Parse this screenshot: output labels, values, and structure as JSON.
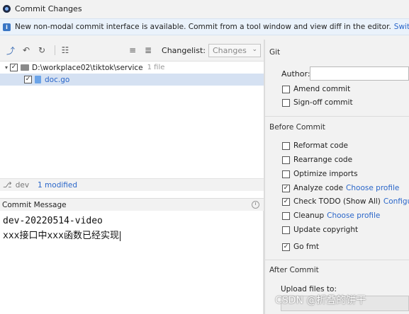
{
  "window": {
    "title": "Commit Changes"
  },
  "banner": {
    "text": "New non-modal commit interface is available. Commit from a tool window and view diff in the editor.",
    "link": "Switch to tool wi"
  },
  "toolbar": {
    "changelist_label": "Changelist:",
    "changelist_value": "Changes"
  },
  "tree": {
    "root_path": "D:\\workplace02\\tiktok\\service",
    "root_meta": "1 file",
    "file": "doc.go"
  },
  "status": {
    "branch": "dev",
    "modified": "1 modified"
  },
  "commit_message": {
    "label": "Commit Message",
    "lines": [
      "dev-20220514-video",
      "xxx接口中xxx函数已经实现"
    ]
  },
  "git": {
    "section": "Git",
    "author_label": "Author:",
    "author_value": "",
    "amend": "Amend commit",
    "signoff": "Sign-off commit"
  },
  "before_commit": {
    "section": "Before Commit",
    "reformat": "Reformat code",
    "rearrange": "Rearrange code",
    "optimize": "Optimize imports",
    "analyze": "Analyze code",
    "analyze_link": "Choose profile",
    "todo": "Check TODO (Show All)",
    "todo_link": "Configure",
    "cleanup": "Cleanup",
    "cleanup_link": "Choose profile",
    "copyright": "Update copyright",
    "gofmt": "Go fmt"
  },
  "after_commit": {
    "section": "After Commit",
    "upload_label": "Upload files to:"
  },
  "watermark": "CSDN @折叠的饼干"
}
